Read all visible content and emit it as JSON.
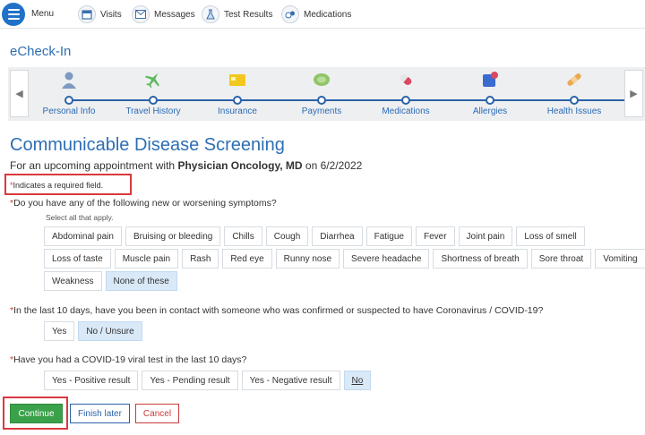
{
  "topnav": {
    "menu_label": "Menu",
    "items": [
      {
        "label": "Visits",
        "icon": "calendar-icon"
      },
      {
        "label": "Messages",
        "icon": "envelope-icon"
      },
      {
        "label": "Test Results",
        "icon": "flask-icon"
      },
      {
        "label": "Medications",
        "icon": "pills-icon"
      }
    ]
  },
  "page_title": "eCheck-In",
  "steps": [
    {
      "label": "Personal Info",
      "icon": "person-icon",
      "color": "#6f8fb5"
    },
    {
      "label": "Travel History",
      "icon": "airplane-icon",
      "color": "#5cb85c"
    },
    {
      "label": "Insurance",
      "icon": "card-icon",
      "color": "#f0c419"
    },
    {
      "label": "Payments",
      "icon": "money-icon",
      "color": "#8fc468"
    },
    {
      "label": "Medications",
      "icon": "pill-icon",
      "color": "#d9485f"
    },
    {
      "label": "Allergies",
      "icon": "allergy-icon",
      "color": "#3a6bd1"
    },
    {
      "label": "Health Issues",
      "icon": "bandage-icon",
      "color": "#e8a94f"
    }
  ],
  "screening": {
    "heading": "Communicable Disease Screening",
    "subtitle_prefix": "For an upcoming appointment with ",
    "provider": "Physician Oncology, MD",
    "subtitle_mid": " on ",
    "date": "6/2/2022",
    "required_note": "Indicates a required field.",
    "q1": {
      "text": "Do you have any of the following new or worsening symptoms?",
      "hint": "Select all that apply.",
      "row1": [
        "Abdominal pain",
        "Bruising or bleeding",
        "Chills",
        "Cough",
        "Diarrhea",
        "Fatigue",
        "Fever",
        "Joint pain",
        "Loss of smell"
      ],
      "row2": [
        "Loss of taste",
        "Muscle pain",
        "Rash",
        "Red eye",
        "Runny nose",
        "Severe headache",
        "Shortness of breath",
        "Sore throat",
        "Vomiting"
      ],
      "row3": [
        "Weakness",
        "None of these"
      ],
      "selected": "None of these"
    },
    "q2": {
      "text": "In the last 10 days, have you been in contact with someone who was confirmed or suspected to have Coronavirus / COVID-19?",
      "options": [
        "Yes",
        "No / Unsure"
      ],
      "selected": "No / Unsure"
    },
    "q3": {
      "text": "Have you had a COVID-19 viral test in the last 10 days?",
      "options": [
        "Yes - Positive result",
        "Yes - Pending result",
        "Yes - Negative result",
        "No"
      ],
      "selected": "No"
    }
  },
  "buttons": {
    "continue": "Continue",
    "finish_later": "Finish later",
    "cancel": "Cancel"
  },
  "colors": {
    "brand_blue": "#2d6fb3",
    "continue_green": "#3aa14a",
    "cancel_red": "#c63c3c",
    "highlight_red": "#d9393e",
    "selected_chip": "#d9e9f8"
  }
}
